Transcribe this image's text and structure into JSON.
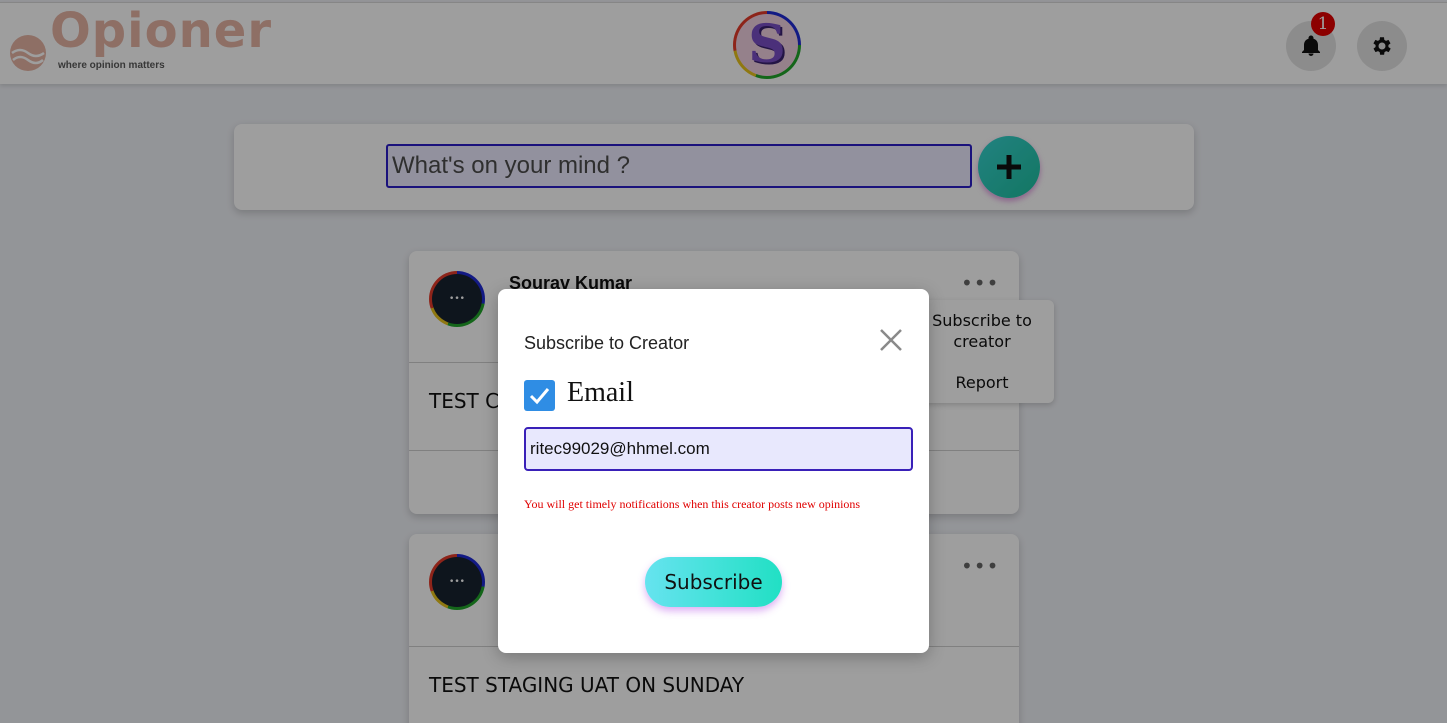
{
  "header": {
    "logo_text": "Opioner",
    "logo_tagline": "where opinion matters",
    "center_avatar_letter": "S",
    "notification_count": "1"
  },
  "composer": {
    "placeholder": "What's on your mind ?"
  },
  "posts": [
    {
      "author": "Sourav Kumar",
      "text": "TEST C"
    },
    {
      "author": "",
      "text": "TEST STAGING UAT ON SUNDAY"
    }
  ],
  "context_menu": {
    "subscribe_line1": "Subscribe to",
    "subscribe_line2": "creator",
    "report": "Report"
  },
  "modal": {
    "title": "Subscribe to Creator",
    "email_label": "Email",
    "email_checked": true,
    "email_value": "ritec99029@hhmel.com",
    "notice": "You will get timely notifications when this creator posts new opinions",
    "subscribe_label": "Subscribe"
  },
  "colors": {
    "brand": "#e5b3a4",
    "accent_teal": "#21e0c4",
    "checkbox_blue": "#2f8de4",
    "input_border": "#3920b8",
    "notice_red": "#e00000",
    "badge_red": "#e20000"
  },
  "icons": [
    "bell-icon",
    "gear-icon",
    "plus-icon",
    "close-icon",
    "more-options-icon",
    "checkmark-icon",
    "logo-wave-icon"
  ]
}
